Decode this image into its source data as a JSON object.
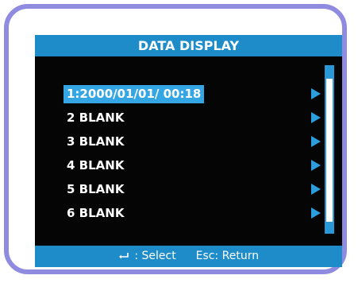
{
  "title": "DATA DISPLAY",
  "items": [
    {
      "label": "1:2000/01/01/ 00:18",
      "selected": true
    },
    {
      "label": "2 BLANK",
      "selected": false
    },
    {
      "label": "3 BLANK",
      "selected": false
    },
    {
      "label": "4 BLANK",
      "selected": false
    },
    {
      "label": "5 BLANK",
      "selected": false
    },
    {
      "label": "6 BLANK",
      "selected": false
    }
  ],
  "footer": {
    "select_icon": "enter-icon",
    "select_text": ": Select",
    "return_text": "Esc: Return"
  },
  "colors": {
    "bezel": "#8f8be0",
    "screen_bg": "#050505",
    "bar_bg": "#1d8cc9",
    "highlight": "#34a6e4",
    "arrow": "#2b9ee0"
  }
}
